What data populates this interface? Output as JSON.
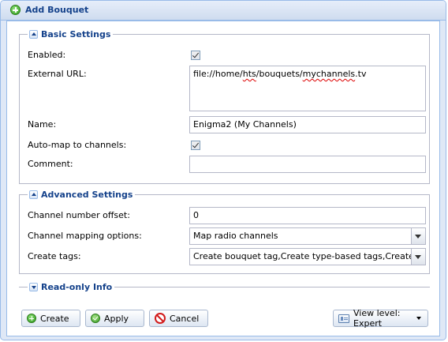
{
  "window": {
    "title": "Add Bouquet"
  },
  "basic": {
    "legend": "Basic Settings",
    "enabled_label": "Enabled:",
    "url_label": "External URL:",
    "url_parts": [
      "file://home/",
      "hts",
      "/bouquets/",
      "mychannels",
      ".tv"
    ],
    "name_label": "Name:",
    "name_value": "Enigma2 (My Channels)",
    "automap_label": "Auto-map to channels:",
    "comment_label": "Comment:",
    "comment_value": ""
  },
  "advanced": {
    "legend": "Advanced Settings",
    "offset_label": "Channel number offset:",
    "offset_value": "0",
    "mapping_label": "Channel mapping options:",
    "mapping_value": "Map radio channels",
    "tags_label": "Create tags:",
    "tags_value": "Create bouquet tag,Create type-based tags,Create provider tags"
  },
  "readonly": {
    "legend": "Read-only Info"
  },
  "footer": {
    "create": "Create",
    "apply": "Apply",
    "cancel": "Cancel",
    "view_level": "View level: Expert"
  }
}
